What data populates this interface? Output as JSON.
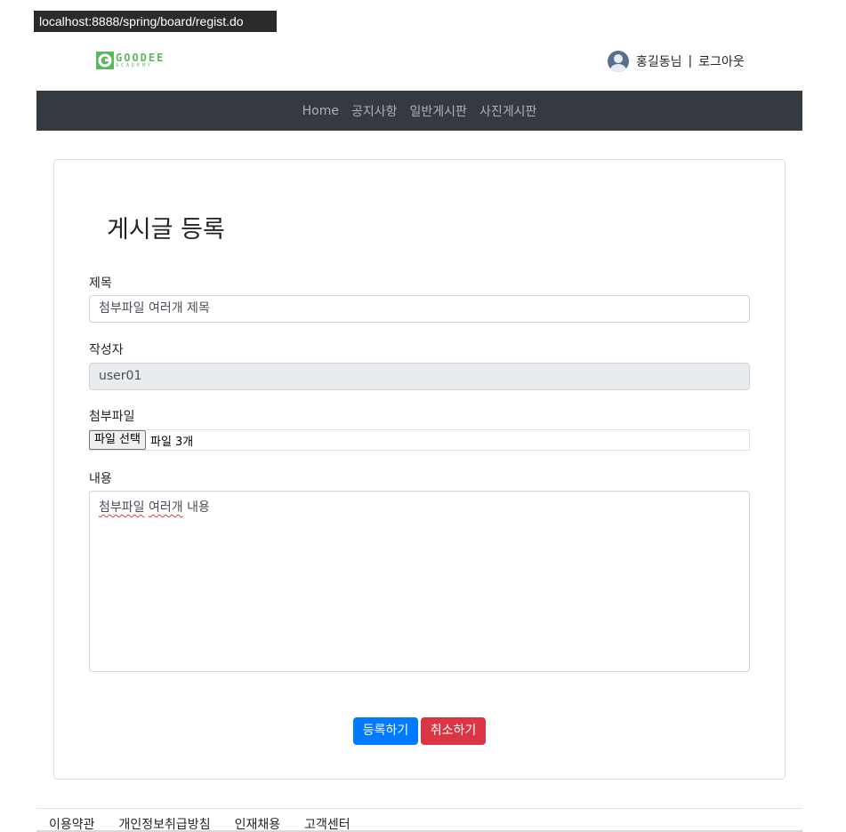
{
  "browser": {
    "url": "localhost:8888/spring/board/regist.do"
  },
  "header": {
    "logo_text": "GOODEE",
    "logo_sub": "ACADEMY",
    "user_name": "홍길동님",
    "separator": "|",
    "logout_label": "로그아웃"
  },
  "nav": {
    "items": [
      "Home",
      "공지사항",
      "일반게시판",
      "사진게시판"
    ]
  },
  "form": {
    "page_title": "게시글 등록",
    "title_label": "제목",
    "title_value": "첨부파일 여러개 제목",
    "writer_label": "작성자",
    "writer_value": "user01",
    "file_label": "첨부파일",
    "file_button": "파일 선택",
    "file_status": "파일 3개",
    "content_label": "내용",
    "content_value_words": [
      "첨부파일",
      "여러개",
      "내용"
    ],
    "submit_label": "등록하기",
    "cancel_label": "취소하기"
  },
  "footer": {
    "links": [
      "이용약관",
      "개인정보취급방침",
      "인재채용",
      "고객센터"
    ]
  },
  "colors": {
    "navbar": "#343a40",
    "primary": "#007bff",
    "danger": "#dc3545",
    "logo_green": "#5cb85c"
  }
}
